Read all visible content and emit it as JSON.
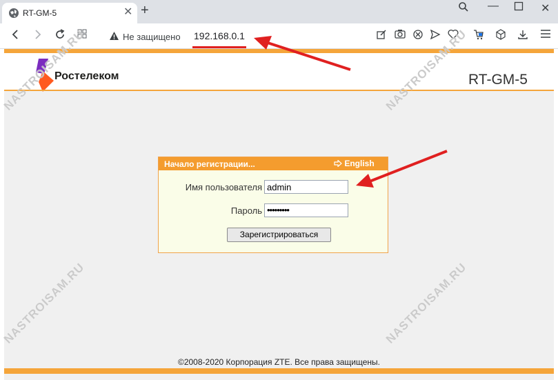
{
  "browser": {
    "tab_title": "RT-GM-5",
    "new_tab_symbol": "+",
    "insecure_label": "Не защищено",
    "url": "192.168.0.1"
  },
  "page": {
    "brand": "Ростелеком",
    "model": "RT-GM-5",
    "login": {
      "heading": "Начало регистрации...",
      "language_link": "English",
      "username_label": "Имя пользователя",
      "username_value": "admin",
      "password_label": "Пароль",
      "password_mask": "•••••••••",
      "submit_label": "Зарегистрироваться"
    },
    "footer": "©2008-2020 Корпорация ZTE. Все права защищены."
  },
  "watermark": "NASTROISAM.RU",
  "colors": {
    "accent_orange": "#f49c2e",
    "logo_purple": "#7b2cbf",
    "logo_orange": "#ff5a1f",
    "annotation_red": "#e02020"
  }
}
